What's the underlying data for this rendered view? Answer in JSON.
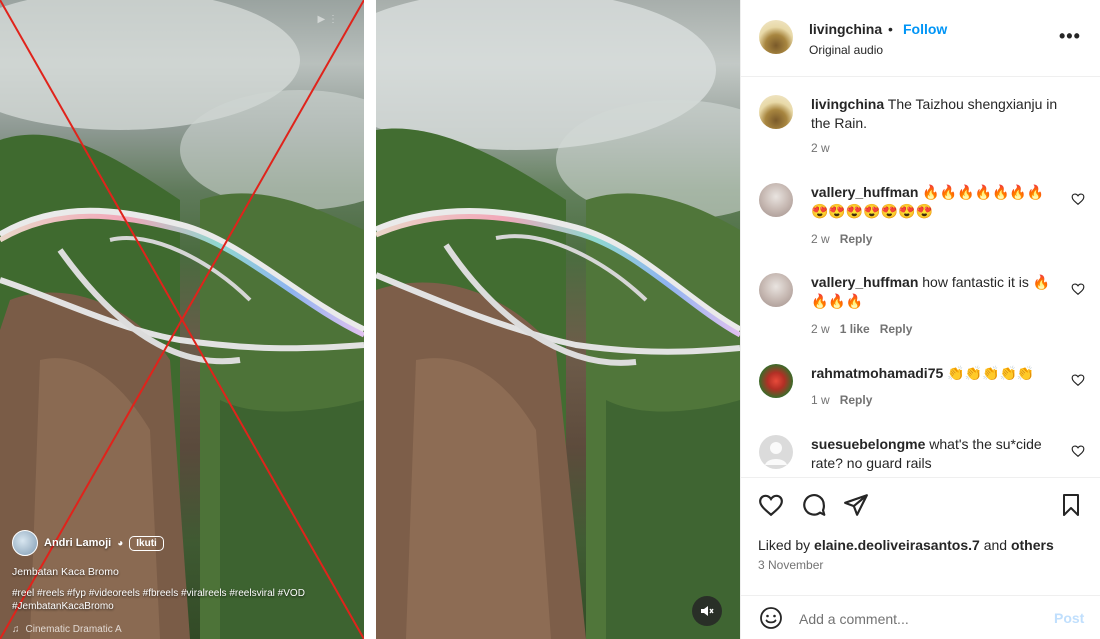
{
  "reel": {
    "author": "Andri Lamoji",
    "follow_label": "Ikuti",
    "caption": "Jembatan Kaca Bromo",
    "tags": "#reel #reels #fyp #videoreels #fbreels #viralreels #reelsviral #VOD #JembatanKacaBromo",
    "music": "Cinematic Dramatic A"
  },
  "post": {
    "username": "livingchina",
    "separator": "•",
    "follow_label": "Follow",
    "audio": "Original audio",
    "more": "•••"
  },
  "comments": [
    {
      "user": "livingchina",
      "text": "The Taizhou shengxianju in the Rain.",
      "time": "2 w",
      "likes": "",
      "reply": ""
    },
    {
      "user": "vallery_huffman",
      "text": "🔥🔥🔥🔥🔥🔥🔥 😍😍😍😍😍😍😍",
      "time": "2 w",
      "likes": "",
      "reply": "Reply"
    },
    {
      "user": "vallery_huffman",
      "text": "how fantastic it is 🔥🔥🔥🔥",
      "time": "2 w",
      "likes": "1 like",
      "reply": "Reply"
    },
    {
      "user": "rahmatmohamadi75",
      "text": "👏👏👏👏👏",
      "time": "1 w",
      "likes": "",
      "reply": "Reply"
    },
    {
      "user": "suesuebelongme",
      "text": "what's the su*cide rate? no guard rails",
      "time": "",
      "likes": "",
      "reply": ""
    }
  ],
  "actions": {
    "liked_prefix": "Liked by",
    "liked_user": "elaine.deoliveirasantos.7",
    "liked_and": "and",
    "liked_others": "others",
    "date": "3 November"
  },
  "comment_box": {
    "placeholder": "Add a comment...",
    "post_label": "Post"
  },
  "colors": {
    "accent": "#0095f6",
    "cross": "#e0231b"
  }
}
